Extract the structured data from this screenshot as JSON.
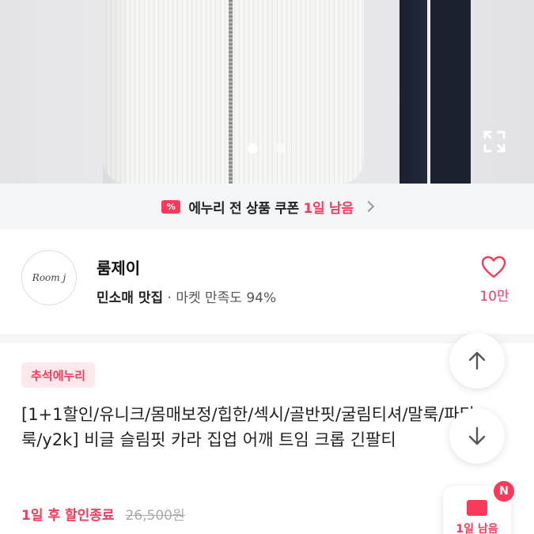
{
  "hero": {
    "active_slide": 1,
    "slide_count": 2
  },
  "coupon": {
    "icon_text": "%",
    "text_main": "에누리 전 상품 쿠폰 ",
    "text_highlight": "1일 남음"
  },
  "shop": {
    "logo_text": "Room j",
    "name": "룸제이",
    "tag": "민소매 맛집",
    "satisfaction": " · 마켓 만족도 94%",
    "likes": "10만"
  },
  "product": {
    "badge": "추석에누리",
    "title": "[1+1할인/유니크/몸매보정/힙한/섹시/골반핏/굴림티셔/말룩/파티룩/y2k] 비글 슬림핏 카라 집업 어깨 트임 크롭 긴팔티",
    "sale_end": "1일 후 할인종료",
    "original_price": "26,500원"
  },
  "floating": {
    "new_badge": "N",
    "coupon_label": "1일 남음"
  },
  "colors": {
    "accent": "#fa3a5a"
  }
}
